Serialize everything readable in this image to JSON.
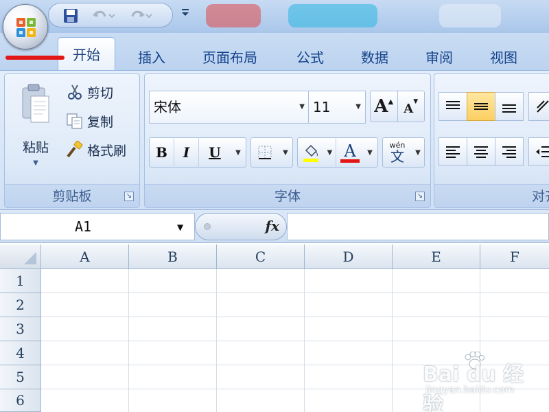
{
  "quick_access": {
    "save_icon": "save-icon",
    "undo_icon": "undo-icon",
    "redo_icon": "redo-icon",
    "customize_icon": "dropdown-arrow-icon"
  },
  "office_button": {
    "icon": "office-logo-icon"
  },
  "tabs": [
    {
      "label": "开始",
      "active": true
    },
    {
      "label": "插入"
    },
    {
      "label": "页面布局"
    },
    {
      "label": "公式"
    },
    {
      "label": "数据"
    },
    {
      "label": "审阅"
    },
    {
      "label": "视图"
    }
  ],
  "clipboard": {
    "paste_label": "粘贴",
    "cut_label": "剪切",
    "copy_label": "复制",
    "format_painter_label": "格式刷",
    "group_label": "剪贴板"
  },
  "font": {
    "font_name": "宋体",
    "font_size": "11",
    "bold": "B",
    "italic": "I",
    "underline": "U",
    "font_color_glyph": "A",
    "grow_glyph": "A",
    "shrink_glyph": "A",
    "phonetic_top": "wén",
    "phonetic_char": "文",
    "group_label": "字体"
  },
  "alignment": {
    "group_label": "对齐"
  },
  "formula_bar": {
    "name_box": "A1",
    "fx_label": "fx",
    "formula": ""
  },
  "grid": {
    "columns": [
      "A",
      "B",
      "C",
      "D",
      "E",
      "F"
    ],
    "rows": [
      "1",
      "2",
      "3",
      "4",
      "5",
      "6"
    ]
  },
  "watermark": {
    "text": "Bai du 经验",
    "url": "jingyan.baidu.com"
  },
  "colors": {
    "highlight_yellow": "#ffff00",
    "font_red": "#e31616",
    "tab_text": "#15428b",
    "annotation_red": "#e31616"
  }
}
